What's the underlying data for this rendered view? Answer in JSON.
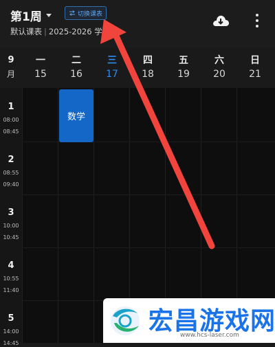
{
  "header": {
    "week_title": "第1周",
    "switch_label": "切换课表",
    "schedule_name": "默认课表",
    "term": "2025-2026 学期"
  },
  "icons": {
    "dropdown": "caret-down-icon",
    "switch": "swap-icon",
    "cloud": "cloud-download-icon",
    "more": "more-vertical-icon"
  },
  "month": {
    "number": "9",
    "unit": "月"
  },
  "days": [
    {
      "weekday": "一",
      "date": "15"
    },
    {
      "weekday": "二",
      "date": "16"
    },
    {
      "weekday": "三",
      "date": "17"
    },
    {
      "weekday": "四",
      "date": "18"
    },
    {
      "weekday": "五",
      "date": "19"
    },
    {
      "weekday": "六",
      "date": "20"
    },
    {
      "weekday": "日",
      "date": "21"
    }
  ],
  "today_index": 2,
  "periods": [
    {
      "num": "1",
      "start": "08:00",
      "end": "08:45"
    },
    {
      "num": "2",
      "start": "08:55",
      "end": "09:40"
    },
    {
      "num": "3",
      "start": "10:00",
      "end": "10:45"
    },
    {
      "num": "4",
      "start": "10:55",
      "end": "11:40"
    },
    {
      "num": "5",
      "start": "14:00",
      "end": "14:45"
    }
  ],
  "courses": [
    {
      "name": "数学",
      "day": "二",
      "periods": "1"
    }
  ],
  "watermark": {
    "text": "宏昌游戏网",
    "url": "www.hcs-laser.com"
  },
  "colors": {
    "accent": "#2f8cf0",
    "course": "#1467c7",
    "arrow": "#f0443c",
    "watermark_text": "#1a73e8"
  }
}
